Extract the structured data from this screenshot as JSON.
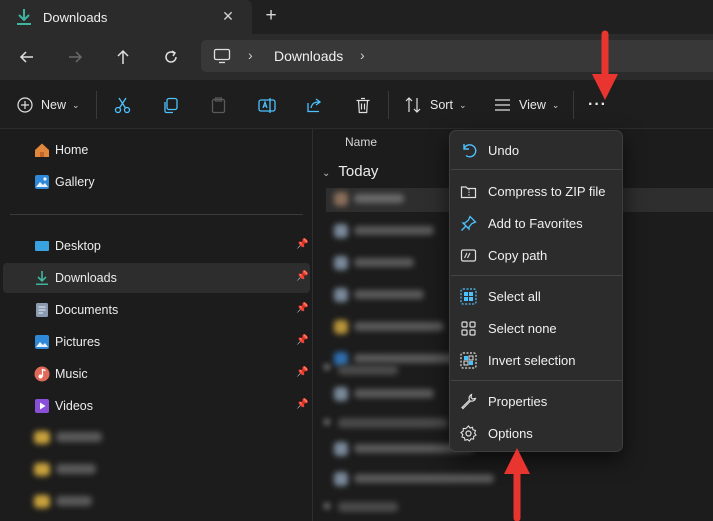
{
  "tab": {
    "title": "Downloads",
    "close_glyph": "✕",
    "new_tab_glyph": "+"
  },
  "address": {
    "crumb": "Downloads",
    "separator": "›"
  },
  "toolbar": {
    "new_label": "New",
    "sort_label": "Sort",
    "view_label": "View",
    "more_glyph": "···",
    "chevron": "⌄"
  },
  "sidebar": {
    "items": [
      {
        "label": "Home",
        "icon": "home-icon",
        "pinned": false
      },
      {
        "label": "Gallery",
        "icon": "gallery-icon",
        "pinned": false
      },
      {
        "label": "Desktop",
        "icon": "desktop-icon",
        "pinned": true
      },
      {
        "label": "Downloads",
        "icon": "download-icon",
        "pinned": true,
        "selected": true
      },
      {
        "label": "Documents",
        "icon": "documents-icon",
        "pinned": true
      },
      {
        "label": "Pictures",
        "icon": "pictures-icon",
        "pinned": true
      },
      {
        "label": "Music",
        "icon": "music-icon",
        "pinned": true
      },
      {
        "label": "Videos",
        "icon": "videos-icon",
        "pinned": true
      }
    ],
    "pin_glyph": "📌"
  },
  "content": {
    "column_header": "Name",
    "group_today": "Today",
    "group_chevron": "⌄"
  },
  "menu": {
    "items": [
      {
        "label": "Undo",
        "icon": "undo-icon"
      },
      {
        "label": "Compress to ZIP file",
        "icon": "zip-icon"
      },
      {
        "label": "Add to Favorites",
        "icon": "pin-icon"
      },
      {
        "label": "Copy path",
        "icon": "copy-path-icon"
      },
      {
        "label": "Select all",
        "icon": "select-all-icon"
      },
      {
        "label": "Select none",
        "icon": "select-none-icon"
      },
      {
        "label": "Invert selection",
        "icon": "invert-selection-icon"
      },
      {
        "label": "Properties",
        "icon": "wrench-icon"
      },
      {
        "label": "Options",
        "icon": "gear-icon"
      }
    ]
  },
  "colors": {
    "accent": "#4cc2ff",
    "annotation_red": "#e8352f",
    "menu_bg": "#2c2c2c",
    "window_bg": "#1c1c1c"
  }
}
